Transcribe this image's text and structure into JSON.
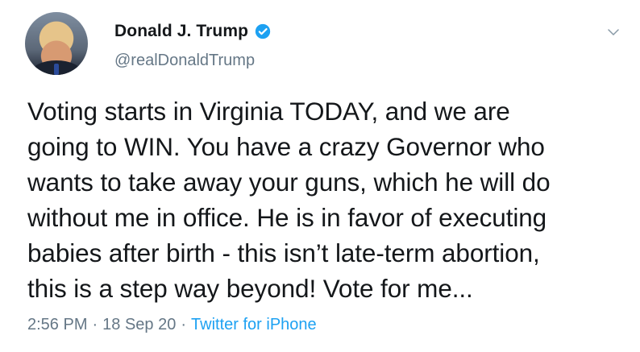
{
  "author": {
    "display_name": "Donald J. Trump",
    "handle": "@realDonaldTrump",
    "verified": true
  },
  "tweet": {
    "text": "Voting starts in Virginia TODAY, and we are\ngoing to WIN. You have a crazy Governor who\nwants to take away your guns, which he will do\nwithout me in office. He is in favor of executing\nbabies after birth - this isn’t late-term abortion,\nthis is a step way beyond! Vote for me...",
    "time": "2:56 PM",
    "date": "18 Sep 20",
    "source": "Twitter for iPhone",
    "separator": "·"
  },
  "icons": {
    "verified": "verified-badge-icon",
    "menu": "chevron-down-icon"
  },
  "colors": {
    "link_blue": "#1da1f2",
    "muted_gray": "#657786",
    "text": "#14171a"
  }
}
